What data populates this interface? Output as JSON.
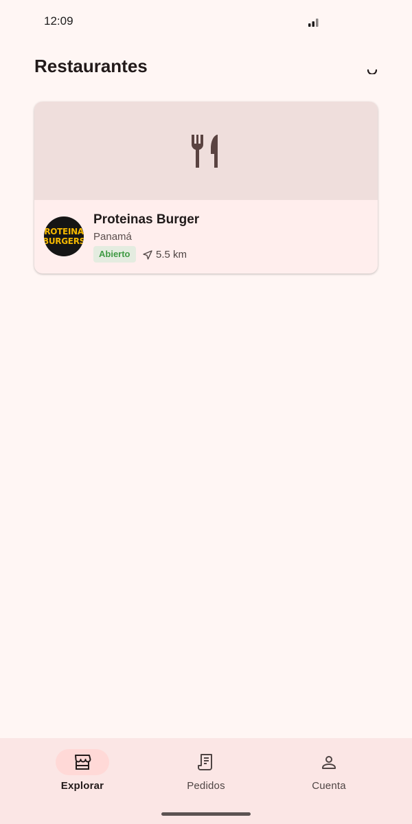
{
  "status_bar": {
    "time": "12:09"
  },
  "header": {
    "title": "Restaurantes"
  },
  "restaurants": [
    {
      "name": "Proteinas Burger",
      "location": "Panamá",
      "status": "Abierto",
      "distance": "5.5 km",
      "logo_text": [
        "PROTEINAS",
        "BURGERS"
      ]
    }
  ],
  "bottom_nav": {
    "items": [
      {
        "label": "Explorar",
        "icon": "storefront-icon",
        "active": true
      },
      {
        "label": "Pedidos",
        "icon": "receipt-icon",
        "active": false
      },
      {
        "label": "Cuenta",
        "icon": "person-icon",
        "active": false
      }
    ]
  },
  "colors": {
    "background": "#fff6f4",
    "card_banner": "#efdedc",
    "badge_green": "#3f9a43",
    "nav_active": "#ffd9d7"
  }
}
